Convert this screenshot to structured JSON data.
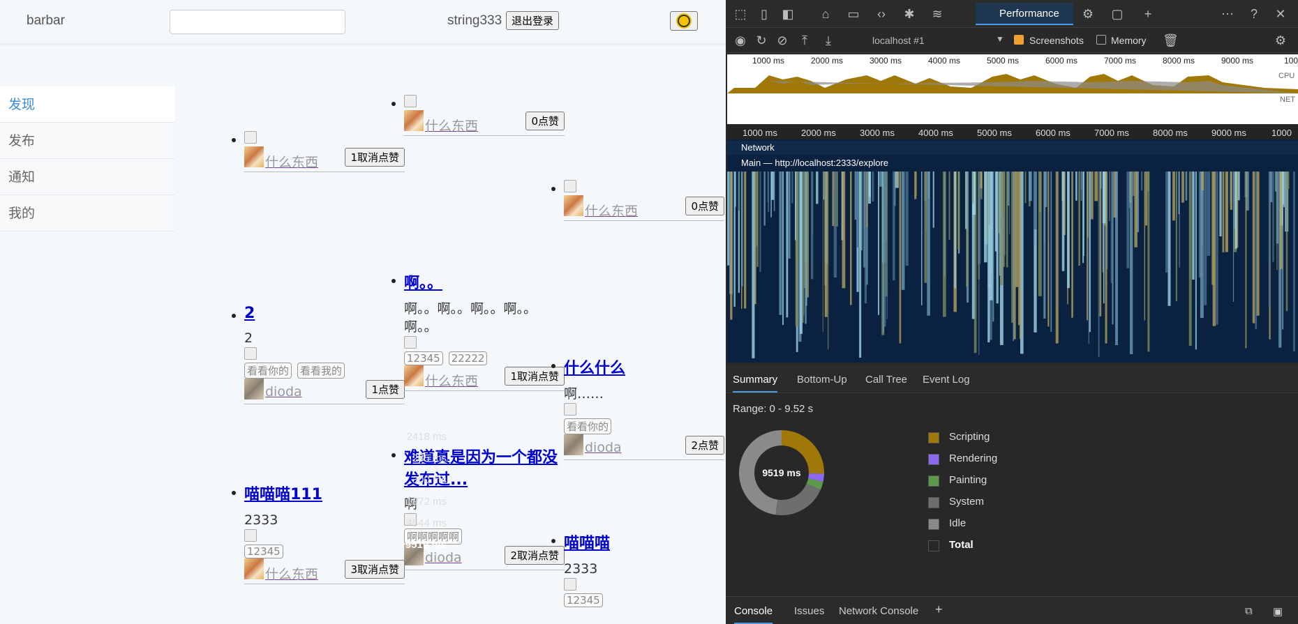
{
  "app": {
    "brand": "barbar",
    "search_placeholder": "",
    "username": "string333",
    "logout_label": "退出登录",
    "theme_icon": "sun-icon"
  },
  "sidebar": {
    "items": [
      {
        "label": "发现",
        "active": true
      },
      {
        "label": "发布",
        "active": false
      },
      {
        "label": "通知",
        "active": false
      },
      {
        "label": "我的",
        "active": false
      }
    ]
  },
  "feed": {
    "col1": [
      {
        "title": "",
        "desc": "",
        "tags": [],
        "author": "什么东西",
        "like_label": "1取消点赞"
      },
      {
        "title": "2",
        "desc": "2",
        "tags": [
          "看看你的",
          "看看我的"
        ],
        "author": "dioda",
        "like_label": "1点赞"
      },
      {
        "title": "喵喵喵111",
        "desc": "2333",
        "tags": [
          "12345"
        ],
        "author": "什么东西",
        "like_label": "3取消点赞"
      }
    ],
    "col2": [
      {
        "title": "",
        "desc": "",
        "tags": [],
        "author": "什么东西",
        "like_label": "0点赞"
      },
      {
        "title": "啊。。",
        "desc": "啊。。啊。。啊。。啊。。啊。。",
        "tags": [
          "12345",
          "22222"
        ],
        "author": "什么东西",
        "like_label": "1取消点赞"
      },
      {
        "title": "难道真是因为一个都没发布过...",
        "desc": "啊",
        "tags": [
          "啊啊啊啊啊"
        ],
        "author": "dioda",
        "like_label": "2取消点赞"
      }
    ],
    "col3": [
      {
        "title": "",
        "desc": "",
        "tags": [],
        "author": "什么东西",
        "like_label": "0点赞"
      },
      {
        "title": "什么什么",
        "desc": "啊……",
        "tags": [
          "看看你的"
        ],
        "author": "dioda",
        "like_label": "2点赞"
      },
      {
        "title": "喵喵喵",
        "desc": "2333",
        "tags": [
          "12345"
        ],
        "author": "",
        "like_label": ""
      }
    ]
  },
  "devtools": {
    "tab_active": "Performance",
    "profile_select": "localhost #1",
    "screenshots_label": "Screenshots",
    "memory_label": "Memory",
    "ruler_ticks": [
      "1000 ms",
      "2000 ms",
      "3000 ms",
      "4000 ms",
      "5000 ms",
      "6000 ms",
      "7000 ms",
      "8000 ms",
      "9000 ms",
      "1000"
    ],
    "cpu_label": "CPU",
    "net_label": "NET",
    "track_network": "Network",
    "track_main": "Main — http://localhost:2333/explore",
    "summary_tabs": [
      "Summary",
      "Bottom-Up",
      "Call Tree",
      "Event Log"
    ],
    "range": "Range: 0 - 9.52 s",
    "donut_center": "9519 ms",
    "breakdown": [
      {
        "value": "2418 ms",
        "name": "Scripting",
        "color": "#a07808",
        "ms": 2418
      },
      {
        "value": "285 ms",
        "name": "Rendering",
        "color": "#8c6af0",
        "ms": 285
      },
      {
        "value": "300 ms",
        "name": "Painting",
        "color": "#5a9a4a",
        "ms": 300
      },
      {
        "value": "1972 ms",
        "name": "System",
        "color": "#6e6e6e",
        "ms": 1972
      },
      {
        "value": "4544 ms",
        "name": "Idle",
        "color": "#8a8a8a",
        "ms": 4544
      },
      {
        "value": "9519 ms",
        "name": "Total",
        "color": "#282828",
        "ms": 9519
      }
    ],
    "drawer_tabs": [
      "Console",
      "Issues",
      "Network Console"
    ]
  }
}
